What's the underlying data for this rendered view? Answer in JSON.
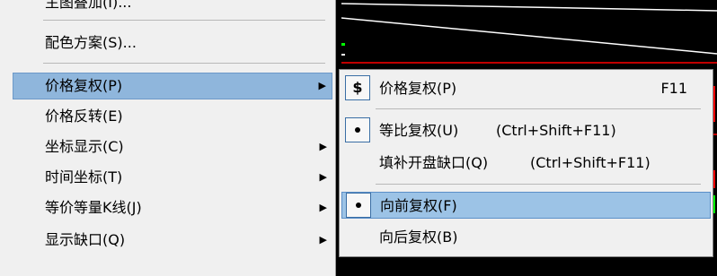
{
  "main_menu": {
    "items": [
      {
        "label": "主图叠加(I)..."
      },
      {
        "label": "配色方案(S)..."
      },
      {
        "label": "价格复权(P)"
      },
      {
        "label": "价格反转(E)"
      },
      {
        "label": "坐标显示(C)"
      },
      {
        "label": "时间坐标(T)"
      },
      {
        "label": "等价等量K线(J)"
      },
      {
        "label": "显示缺口(Q)"
      }
    ]
  },
  "sub_menu": {
    "items": [
      {
        "label": "价格复权(P)",
        "shortcut": "F11",
        "icon": "dollar-icon"
      },
      {
        "label": "等比复权(U)",
        "shortcut": "(Ctrl+Shift+F11)",
        "checked": true
      },
      {
        "label": "填补开盘缺口(Q)",
        "shortcut": "(Ctrl+Shift+F11)"
      },
      {
        "label": "向前复权(F)",
        "checked": true
      },
      {
        "label": "向后复权(B)"
      }
    ]
  },
  "colors": {
    "chart_background": "#000000",
    "menu_background": "#f0f0f0",
    "highlight": "#9cc3e6",
    "chart_line_white": "#ffffff",
    "chart_line_red": "#ff0000",
    "chart_line_green": "#00ff00"
  }
}
